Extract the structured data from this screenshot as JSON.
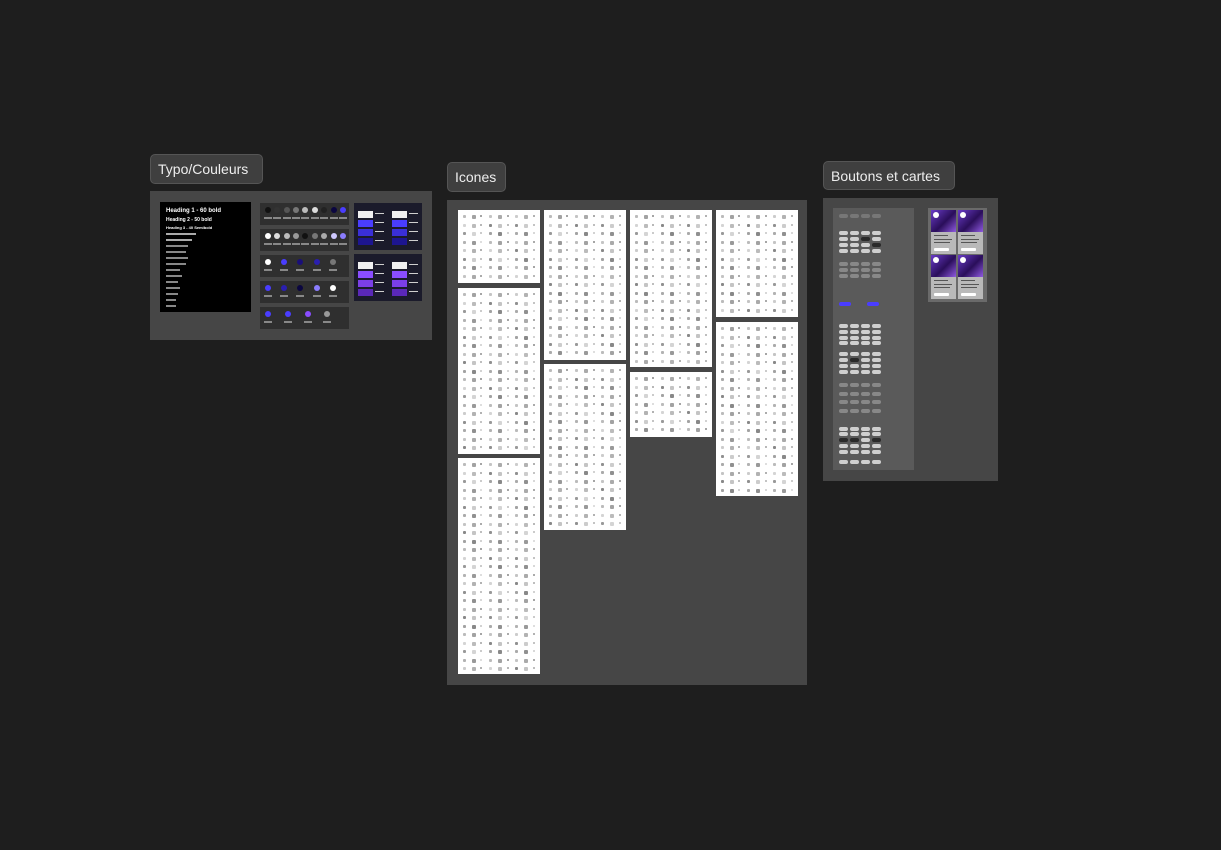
{
  "canvas": {
    "background": "#1e1e1e"
  },
  "frames": {
    "typo": {
      "label": "Typo/Couleurs"
    },
    "icons": {
      "label": "Icones"
    },
    "buttons": {
      "label": "Boutons et cartes"
    }
  },
  "typography": {
    "heading1": "Heading 1 - 60 bold",
    "heading2": "Heading 2 - 50 bold",
    "heading3": "Heading 3 - 40 Semibold"
  },
  "colors": {
    "accent": "#4a3dff",
    "accent_light": "#8b7dff",
    "purple": "#8a4dff",
    "section_bg": "#464646",
    "label_bg": "#3f3f3f",
    "sheet_bg": "#ffffff"
  },
  "icons": {
    "glyph": "icon-placeholder"
  }
}
